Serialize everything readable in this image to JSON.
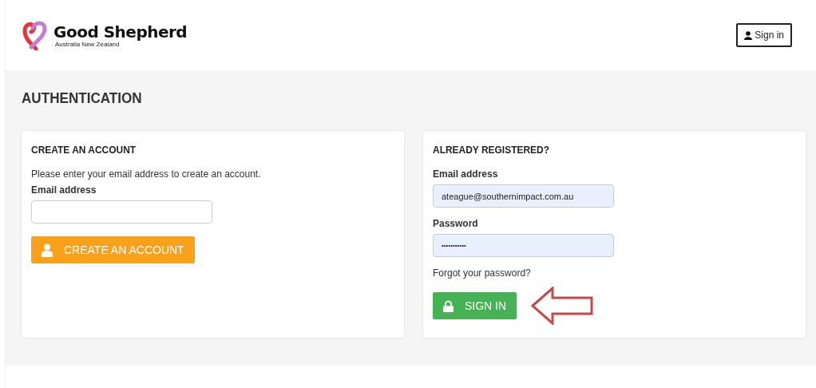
{
  "header": {
    "brand": "Good Shepherd",
    "tagline": "Australia New Zealand",
    "sign_in": "Sign in"
  },
  "page_title": "AUTHENTICATION",
  "create_account": {
    "heading": "CREATE AN ACCOUNT",
    "intro": "Please enter your email address to create an account.",
    "email_label": "Email address",
    "button": "CREATE AN ACCOUNT"
  },
  "already_registered": {
    "heading": "ALREADY REGISTERED?",
    "email_label": "Email address",
    "email_value": "ateague@southernimpact.com.au",
    "password_label": "Password",
    "password_value": "•••••••••••",
    "forgot": "Forgot your password?",
    "button": "SIGN IN"
  }
}
